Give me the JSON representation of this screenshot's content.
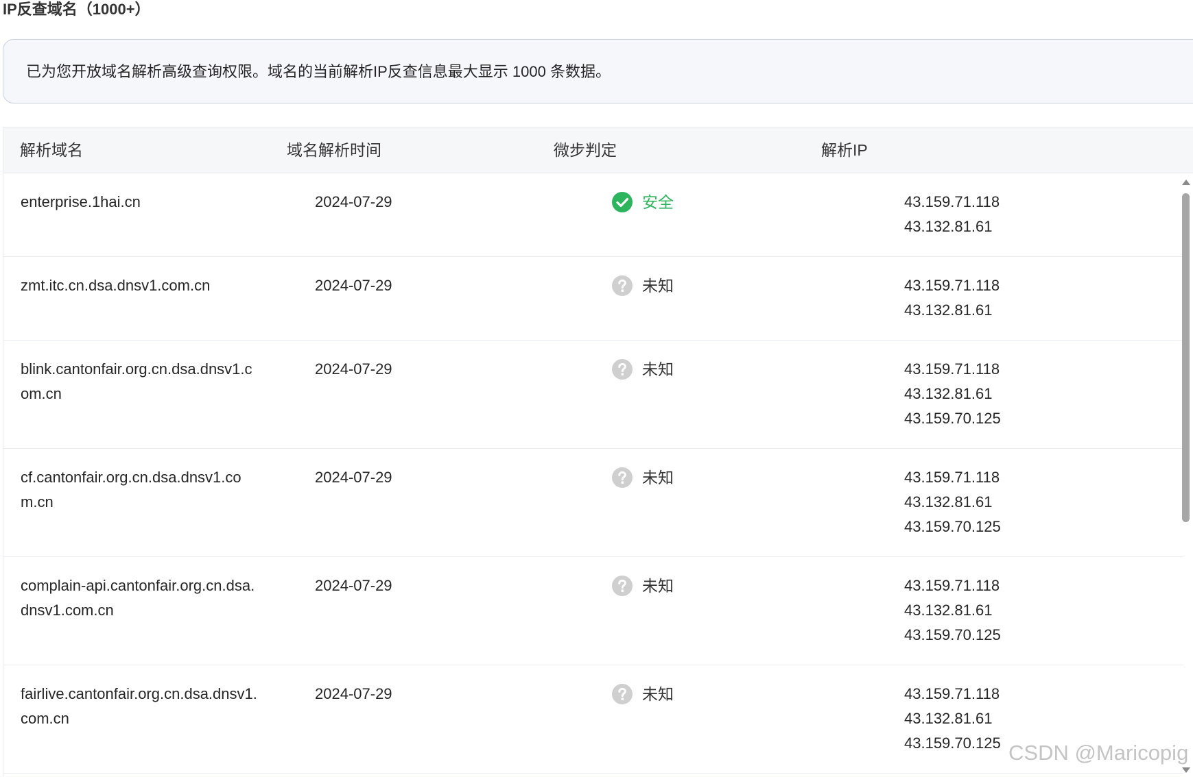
{
  "title": "IP反查域名（1000+）",
  "notice": "已为您开放域名解析高级查询权限。域名的当前解析IP反查信息最大显示 1000 条数据。",
  "columns": {
    "domain": "解析域名",
    "time": "域名解析时间",
    "judge": "微步判定",
    "ip": "解析IP"
  },
  "colors": {
    "safe": "#2db55d",
    "unknown_icon": "#cfcfcf",
    "unknown_text": "#333333"
  },
  "rows": [
    {
      "domain": "enterprise.1hai.cn",
      "time": "2024-07-29",
      "status": "安全",
      "status_icon": "check-circle-icon",
      "ips": [
        "43.159.71.118",
        "43.132.81.61"
      ]
    },
    {
      "domain": "zmt.itc.cn.dsa.dnsv1.com.cn",
      "time": "2024-07-29",
      "status": "未知",
      "status_icon": "question-circle-icon",
      "ips": [
        "43.159.71.118",
        "43.132.81.61"
      ]
    },
    {
      "domain": "blink.cantonfair.org.cn.dsa.dnsv1.com.cn",
      "time": "2024-07-29",
      "status": "未知",
      "status_icon": "question-circle-icon",
      "ips": [
        "43.159.71.118",
        "43.132.81.61",
        "43.159.70.125"
      ]
    },
    {
      "domain": "cf.cantonfair.org.cn.dsa.dnsv1.com.cn",
      "time": "2024-07-29",
      "status": "未知",
      "status_icon": "question-circle-icon",
      "ips": [
        "43.159.71.118",
        "43.132.81.61",
        "43.159.70.125"
      ]
    },
    {
      "domain": "complain-api.cantonfair.org.cn.dsa.dnsv1.com.cn",
      "time": "2024-07-29",
      "status": "未知",
      "status_icon": "question-circle-icon",
      "ips": [
        "43.159.71.118",
        "43.132.81.61",
        "43.159.70.125"
      ]
    },
    {
      "domain": "fairlive.cantonfair.org.cn.dsa.dnsv1.com.cn",
      "time": "2024-07-29",
      "status": "未知",
      "status_icon": "question-circle-icon",
      "ips": [
        "43.159.71.118",
        "43.132.81.61",
        "43.159.70.125"
      ]
    }
  ],
  "watermark": "CSDN @Maricopig"
}
